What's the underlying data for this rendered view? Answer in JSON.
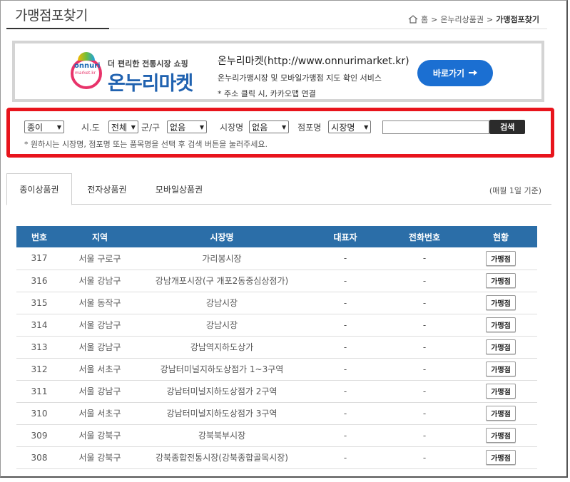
{
  "header": {
    "title": "가맹점포찾기",
    "breadcrumb": [
      "홈",
      "온누리상품권",
      "가맹점포찾기"
    ],
    "breadcrumb_sep": ">"
  },
  "banner": {
    "logo_small_top": "onnuri",
    "logo_small_bottom": "market.kr",
    "tagline": "더 편리한 전통시장 쇼핑",
    "brand_name": "온누리마켓",
    "line1": "온누리마켓(http://www.onnurimarket.kr)",
    "line2": "온누리가맹시장 및 모바일가맹점 지도 확인 서비스",
    "line3": "* 주소 클릭 시, 카카오맵 연결",
    "button_label": "바로가기",
    "button_color": "#1b6fd2"
  },
  "search": {
    "type_value": "종이",
    "sido_label": "시.도",
    "sido_value": "전체",
    "gugun_label": "군/구",
    "gugun_value": "없음",
    "market_label": "시장명",
    "market_value": "없음",
    "store_label": "점포명",
    "store_select_value": "시장명",
    "keyword_value": "",
    "button_label": "검색",
    "hint": "* 원하시는 시장명, 점포명 또는 품목명을 선택 후 검색 버튼을 눌러주세요.",
    "highlight_color": "#e8141c"
  },
  "tabs": {
    "items": [
      "종이상품권",
      "전자상품권",
      "모바일상품권"
    ],
    "active": "종이상품권",
    "note": "(매월 1일 기준)"
  },
  "table": {
    "headers": [
      "번호",
      "지역",
      "시장명",
      "대표자",
      "전화번호",
      "현황"
    ],
    "header_color": "#2b6ea8",
    "rows": [
      {
        "no": "317",
        "region": "서울 구로구",
        "market": "가리봉시장",
        "rep": "-",
        "tel": "-",
        "status": "가맹점"
      },
      {
        "no": "316",
        "region": "서울 강남구",
        "market": "강남개포시장(구 개포2동중심상점가)",
        "rep": "-",
        "tel": "-",
        "status": "가맹점"
      },
      {
        "no": "315",
        "region": "서울 동작구",
        "market": "강남시장",
        "rep": "-",
        "tel": "-",
        "status": "가맹점"
      },
      {
        "no": "314",
        "region": "서울 강남구",
        "market": "강남시장",
        "rep": "-",
        "tel": "-",
        "status": "가맹점"
      },
      {
        "no": "313",
        "region": "서울 강남구",
        "market": "강남역지하도상가",
        "rep": "-",
        "tel": "-",
        "status": "가맹점"
      },
      {
        "no": "312",
        "region": "서울 서초구",
        "market": "강남터미널지하도상점가 1~3구역",
        "rep": "-",
        "tel": "-",
        "status": "가맹점"
      },
      {
        "no": "311",
        "region": "서울 강남구",
        "market": "강남터미널지하도상점가 2구역",
        "rep": "-",
        "tel": "-",
        "status": "가맹점"
      },
      {
        "no": "310",
        "region": "서울 서초구",
        "market": "강남터미널지하도상점가 3구역",
        "rep": "-",
        "tel": "-",
        "status": "가맹점"
      },
      {
        "no": "309",
        "region": "서울 강북구",
        "market": "강북북부시장",
        "rep": "-",
        "tel": "-",
        "status": "가맹점"
      },
      {
        "no": "308",
        "region": "서울 강북구",
        "market": "강북종합전통시장(강북종합골목시장)",
        "rep": "-",
        "tel": "-",
        "status": "가맹점"
      }
    ]
  }
}
